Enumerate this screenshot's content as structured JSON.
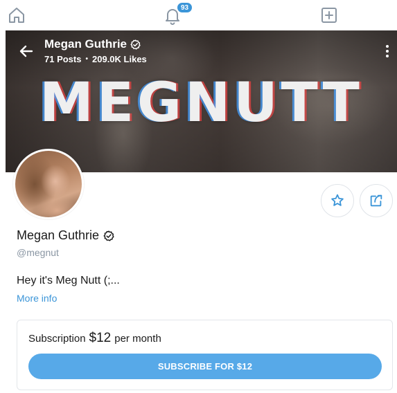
{
  "nav": {
    "home_icon": "home-icon",
    "bell_icon": "bell-icon",
    "notifications_count": "93",
    "add_icon": "add-square-icon"
  },
  "cover": {
    "name": "Megan Guthrie",
    "posts": "71 Posts",
    "likes": "209.0K Likes",
    "separator": "•",
    "banner_text": "MEGNUTT",
    "back_icon": "arrow-left-icon",
    "menu_icon": "more-vertical-icon"
  },
  "profile": {
    "name": "Megan Guthrie",
    "handle": "@megnut",
    "bio": "Hey it's Meg Nutt (;...",
    "more_info": "More info",
    "verified_icon": "verified-icon",
    "favorite_icon": "star-icon",
    "share_icon": "share-icon"
  },
  "subscription": {
    "label": "Subscription",
    "price": "$12",
    "period": "per month",
    "button_label": "SUBSCRIBE FOR $12"
  },
  "colors": {
    "accent": "#3b95d8",
    "button": "#57a9e8",
    "muted": "#8a96a3"
  }
}
